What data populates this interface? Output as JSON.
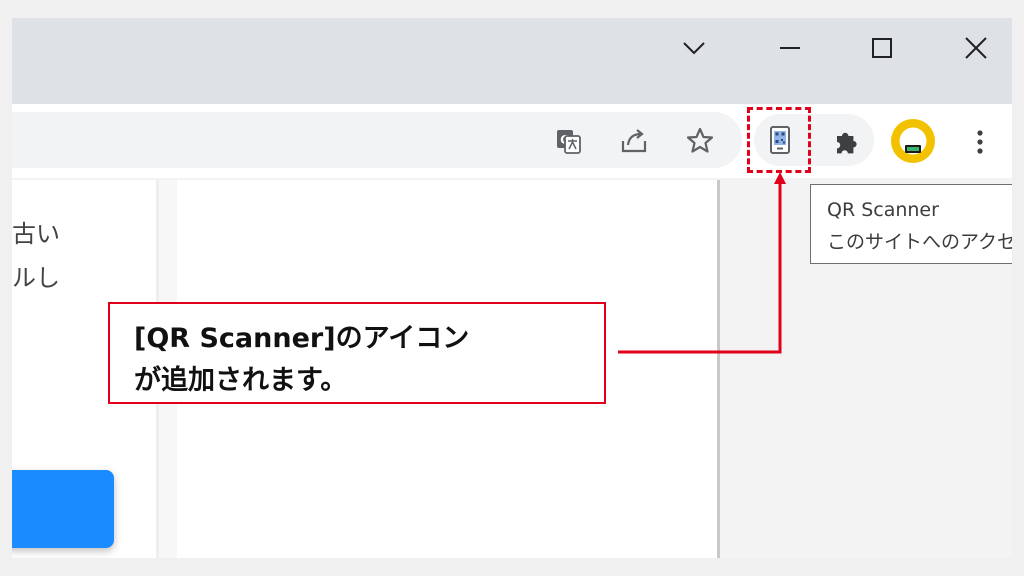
{
  "window": {
    "controls": [
      "chevron-down-icon",
      "minimize-icon",
      "maximize-icon",
      "close-icon"
    ]
  },
  "toolbar": {
    "icons": [
      "translate-icon",
      "share-icon",
      "star-icon",
      "qr-scanner-icon",
      "puzzle-icon",
      "profile-avatar",
      "kebab-menu-icon"
    ]
  },
  "colors": {
    "accent_red": "#e0001b",
    "blue_button": "#1a8cff",
    "avatar_yellow": "#f2c200"
  },
  "page": {
    "partial_lines": [
      "古い",
      "ルし"
    ]
  },
  "tooltip": {
    "title": "QR Scanner",
    "subtitle": "このサイトへのアクセ"
  },
  "callout": {
    "line1": "[QR Scanner]のアイコン",
    "line2": "が追加されます。"
  }
}
